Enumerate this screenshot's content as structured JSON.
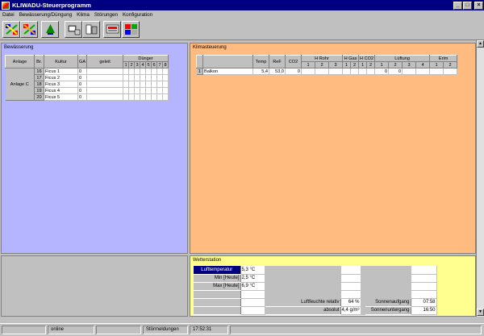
{
  "window": {
    "title": "KLIWADU-Steuerprogramm"
  },
  "menu": [
    "Datei",
    "Bewässerung/Düngung",
    "Klima",
    "Störungen",
    "Konfiguration"
  ],
  "toolbar": {
    "icons": [
      "network-icon",
      "network-alt-icon",
      "plant-icon",
      "computer-icon",
      "printer-icon",
      "monitor-icon",
      "settings-icon"
    ]
  },
  "bew": {
    "title": "Bewässerung",
    "headers": {
      "anlage": "Anlage",
      "br": "Br.",
      "kultur": "Kultur",
      "ga": "GA",
      "geleit": "geleit",
      "duenger": "Dünger"
    },
    "duenger_cols": [
      "1",
      "2",
      "3",
      "4",
      "5",
      "6",
      "7",
      "8"
    ],
    "group": "Anlage C",
    "rows": [
      {
        "br": "16",
        "kultur": "Ficus 1",
        "ga": "0"
      },
      {
        "br": "17",
        "kultur": "Ficus 2",
        "ga": "0"
      },
      {
        "br": "18",
        "kultur": "Ficus 3",
        "ga": "0"
      },
      {
        "br": "19",
        "kultur": "Ficus 4",
        "ga": "0"
      },
      {
        "br": "20",
        "kultur": "Ficus 5",
        "ga": "0"
      }
    ]
  },
  "klima": {
    "title": "Klimasteuerung",
    "headers": {
      "temp": "Temp",
      "ref": "ReF",
      "co2": "CO2",
      "hrohr": "H Rohr",
      "hgas": "H Gas",
      "hco2": "H CO2",
      "lueftung": "Lüftung",
      "erim": "Erim"
    },
    "sub": {
      "hrohr": [
        "1",
        "2",
        "3"
      ],
      "hgas": [
        "1",
        "2"
      ],
      "hco2": [
        "1",
        "2"
      ],
      "lueftung": [
        "1",
        "2",
        "3",
        "4"
      ],
      "erim": [
        "1",
        "2"
      ]
    },
    "row": {
      "nr": "1",
      "name": "Balkon",
      "temp": "5,4",
      "ref": "53,0",
      "co2": "0",
      "l1": "0",
      "l2": "0"
    }
  },
  "wetter": {
    "title": "Wetterstation",
    "rows": [
      {
        "label": "Lufttemperatur",
        "value": "5,3 °C"
      },
      {
        "label": "Min [Heute]",
        "value": "2,5 °C"
      },
      {
        "label": "Max [Heute]",
        "value": "6,9 °C"
      }
    ],
    "feucht_rel_label": "Luftfeuchte relativ",
    "feucht_rel_value": "64 %",
    "feucht_abs_label": "absolut",
    "feucht_abs_value": "4,4 g/m³",
    "sunrise_label": "Sonnenaufgang",
    "sunrise_value": "07:58",
    "sunset_label": "Sonnenuntergang",
    "sunset_value": "16:50"
  },
  "status": {
    "conn": "online",
    "messages": "Störmeldungen",
    "time": "17:52:31"
  },
  "colors": {
    "bew_bg": "#b4b4ff",
    "klima_bg": "#ffbb80",
    "wetter_bg": "#ffff90",
    "title_bg": "#000080"
  }
}
